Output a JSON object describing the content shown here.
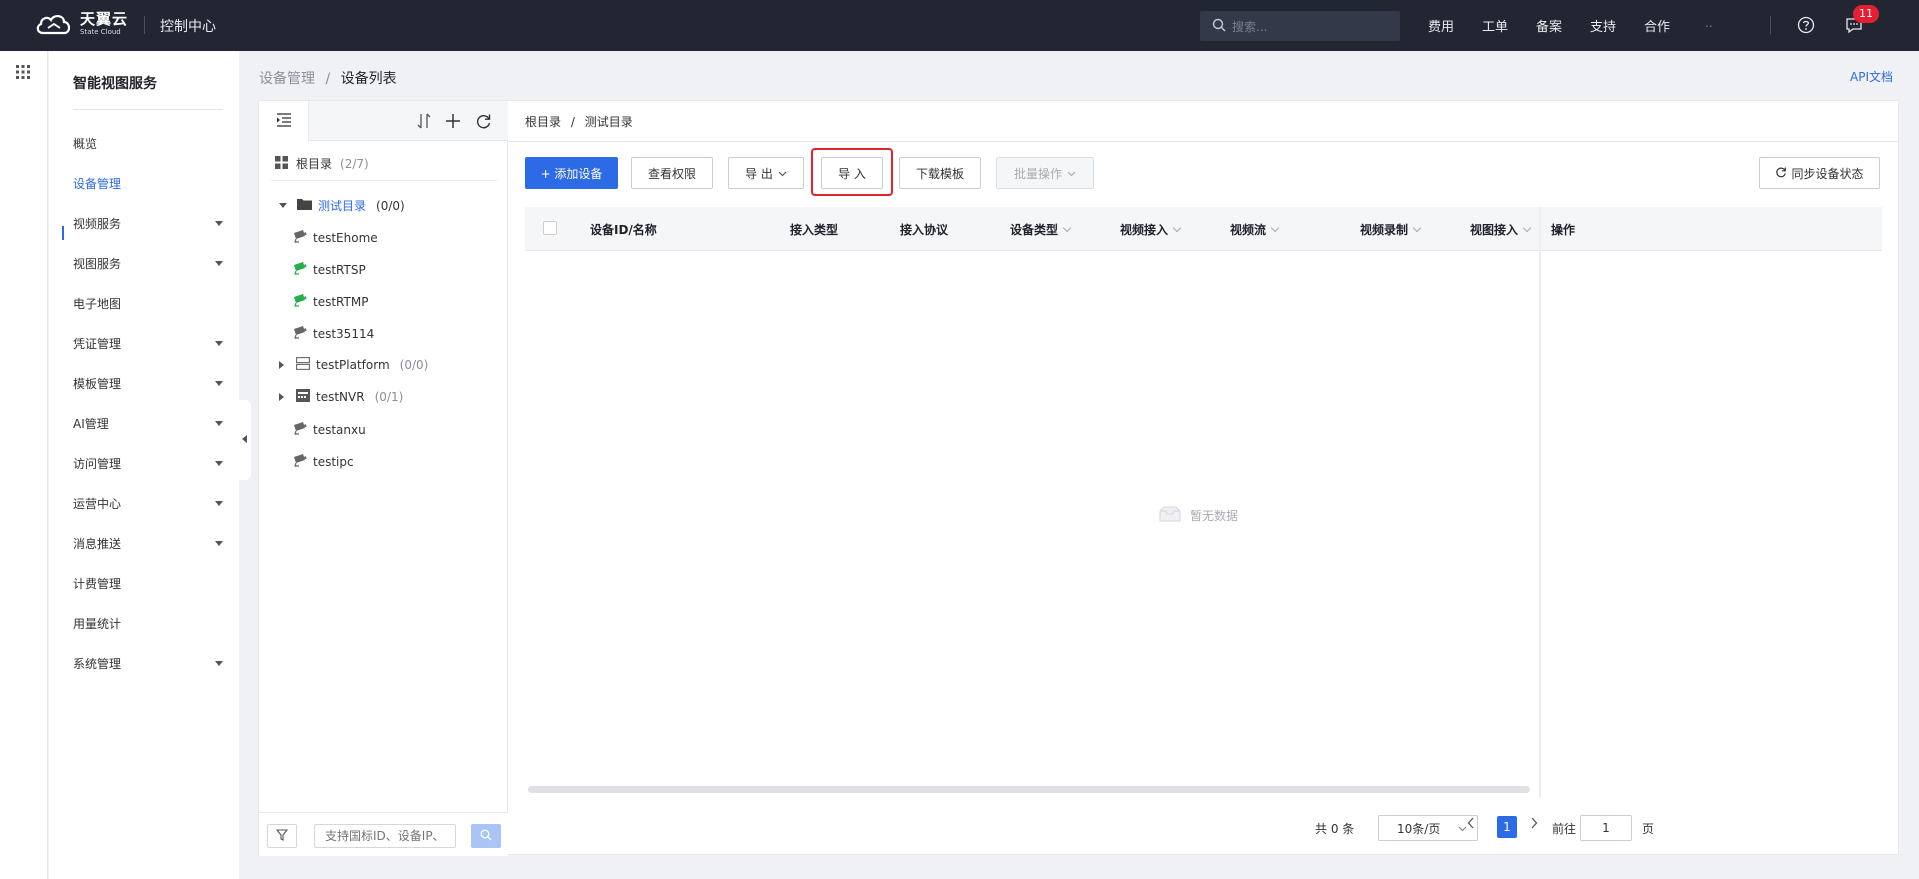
{
  "topbar": {
    "brand_cn": "天翼云",
    "brand_en": "State Cloud",
    "title": "控制中心",
    "search_placeholder": "搜索...",
    "nav": [
      "费用",
      "工单",
      "备案",
      "支持",
      "合作"
    ],
    "account": "..",
    "message_count": "11"
  },
  "sidebar": {
    "title": "智能视图服务",
    "items": [
      {
        "label": "概览",
        "has_children": false
      },
      {
        "label": "设备管理",
        "has_children": false,
        "active": true
      },
      {
        "label": "视频服务",
        "has_children": true
      },
      {
        "label": "视图服务",
        "has_children": true
      },
      {
        "label": "电子地图",
        "has_children": false
      },
      {
        "label": "凭证管理",
        "has_children": true
      },
      {
        "label": "模板管理",
        "has_children": true
      },
      {
        "label": "AI管理",
        "has_children": true
      },
      {
        "label": "访问管理",
        "has_children": true
      },
      {
        "label": "运营中心",
        "has_children": true
      },
      {
        "label": "消息推送",
        "has_children": true
      },
      {
        "label": "计费管理",
        "has_children": false
      },
      {
        "label": "用量统计",
        "has_children": false
      },
      {
        "label": "系统管理",
        "has_children": true
      }
    ]
  },
  "breadcrumb": {
    "parent": "设备管理",
    "separator": "/",
    "current": "设备列表"
  },
  "api_doc": "API文档",
  "tree": {
    "root_label": "根目录",
    "root_count": "(2/7)",
    "nodes": [
      {
        "label": "测试目录",
        "count": "(0/0)",
        "type": "folder",
        "expanded": true,
        "selected": true
      },
      {
        "label": "testEhome",
        "type": "camera",
        "status": "offline"
      },
      {
        "label": "testRTSP",
        "type": "camera",
        "status": "online"
      },
      {
        "label": "testRTMP",
        "type": "camera",
        "status": "online"
      },
      {
        "label": "test35114",
        "type": "camera",
        "status": "offline"
      },
      {
        "label": "testPlatform",
        "count": "(0/0)",
        "type": "platform",
        "expanded": false
      },
      {
        "label": "testNVR",
        "count": "(0/1)",
        "type": "nvr",
        "expanded": false
      },
      {
        "label": "testanxu",
        "type": "camera",
        "status": "offline"
      },
      {
        "label": "testipc",
        "type": "camera",
        "status": "offline"
      }
    ],
    "search_placeholder": "支持国标ID、设备IP、"
  },
  "main": {
    "breadcrumb_root": "根目录",
    "breadcrumb_sep": "/",
    "breadcrumb_current": "测试目录",
    "buttons": {
      "add": "+ 添加设备",
      "permission": "查看权限",
      "export": "导 出",
      "import": "导 入",
      "download_template": "下载模板",
      "batch": "批量操作",
      "sync": "同步设备状态"
    },
    "columns": [
      {
        "label": "设备ID/名称",
        "sortable": false
      },
      {
        "label": "接入类型",
        "sortable": false
      },
      {
        "label": "接入协议",
        "sortable": false
      },
      {
        "label": "设备类型",
        "sortable": true
      },
      {
        "label": "视频接入",
        "sortable": true
      },
      {
        "label": "视频流",
        "sortable": true
      },
      {
        "label": "视频录制",
        "sortable": true
      },
      {
        "label": "视图接入",
        "sortable": true
      },
      {
        "label": "操作",
        "sortable": false
      }
    ],
    "empty_text": "暂无数据",
    "pagination": {
      "total": "共 0 条",
      "page_size": "10条/页",
      "current_page": "1",
      "goto_label": "前往",
      "goto_value": "1",
      "page_unit": "页"
    }
  },
  "colors": {
    "primary": "#2d6ae6",
    "topbar_bg": "#222633",
    "highlight": "#e0242d",
    "online": "#22b04b"
  }
}
